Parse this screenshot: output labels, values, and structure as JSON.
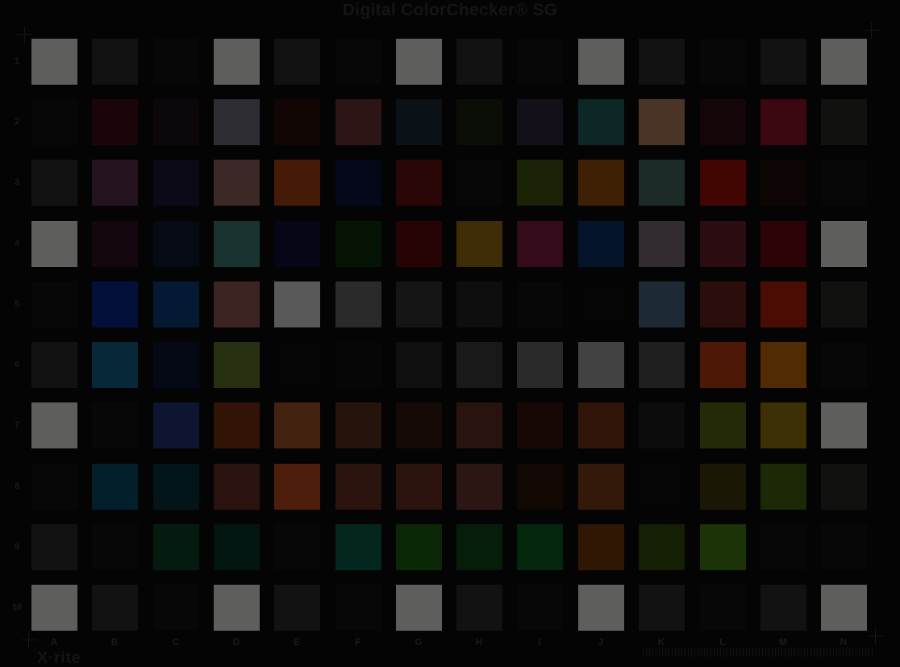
{
  "title": "Digital ColorChecker® SG",
  "brand": "X·rite",
  "columns": [
    "A",
    "B",
    "C",
    "D",
    "E",
    "F",
    "G",
    "H",
    "I",
    "J",
    "K",
    "L",
    "M",
    "N"
  ],
  "rows": [
    "1",
    "2",
    "3",
    "4",
    "5",
    "6",
    "7",
    "8",
    "9",
    "10"
  ],
  "patch_colors": [
    [
      "#5e5e5c",
      "#121212",
      "#070707",
      "#5e5e5c",
      "#121212",
      "#070707",
      "#5e5e5c",
      "#121212",
      "#070707",
      "#5e5e5c",
      "#121212",
      "#070707",
      "#121212",
      "#5e5e5c"
    ],
    [
      "#070707",
      "#1b0509",
      "#0c070a",
      "#2e2d34",
      "#120605",
      "#2c1514",
      "#0a1218",
      "#0a0e07",
      "#13101a",
      "#0d2726",
      "#4a3426",
      "#140608",
      "#3b0811",
      "#111110"
    ],
    [
      "#121212",
      "#24121f",
      "#0d0a18",
      "#3c2826",
      "#451a06",
      "#050818",
      "#2a0707",
      "#070707",
      "#1b2306",
      "#3e2004",
      "#1c2b27",
      "#410502",
      "#0e0505",
      "#070707"
    ],
    [
      "#5e5e5c",
      "#14070f",
      "#060a12",
      "#183330",
      "#050717",
      "#061406",
      "#260406",
      "#3e2c06",
      "#330b1b",
      "#04142a",
      "#322b32",
      "#2b0d11",
      "#2c0306",
      "#5e5e5c"
    ],
    [
      "#070707",
      "#04103a",
      "#061933",
      "#3b2421",
      "#59595a",
      "#2a2a2a",
      "#151515",
      "#0e0e0e",
      "#070707",
      "#050505",
      "#1d2a36",
      "#2b0e0c",
      "#4a0d04",
      "#111110"
    ],
    [
      "#121212",
      "#062839",
      "#050915",
      "#283012",
      "#050505",
      "#060606",
      "#0f0f0f",
      "#191919",
      "#2a2a2a",
      "#424242",
      "#1f1f1f",
      "#4e1806",
      "#502b04",
      "#070707"
    ],
    [
      "#5e5e5c",
      "#070707",
      "#0e1530",
      "#311406",
      "#43220f",
      "#24140b",
      "#150a06",
      "#28130e",
      "#170805",
      "#311508",
      "#0c0c0c",
      "#242a08",
      "#3d2f06",
      "#5e5e5c"
    ],
    [
      "#070707",
      "#031f2b",
      "#031518",
      "#2a130e",
      "#4d1e0c",
      "#2a140d",
      "#2c130d",
      "#2c1613",
      "#110804",
      "#331909",
      "#050505",
      "#1b1706",
      "#1c2806",
      "#111110"
    ],
    [
      "#121212",
      "#070707",
      "#041c10",
      "#031510",
      "#070707",
      "#03261f",
      "#0a2806",
      "#041e0a",
      "#04260c",
      "#301704",
      "#151f04",
      "#1b3307",
      "#070707",
      "#070707"
    ],
    [
      "#5e5e5c",
      "#121212",
      "#070707",
      "#5e5e5c",
      "#121212",
      "#070707",
      "#5e5e5c",
      "#121212",
      "#070707",
      "#5e5e5c",
      "#121212",
      "#070707",
      "#121212",
      "#5e5e5c"
    ]
  ],
  "icons": [
    "registration-mark-icon"
  ]
}
